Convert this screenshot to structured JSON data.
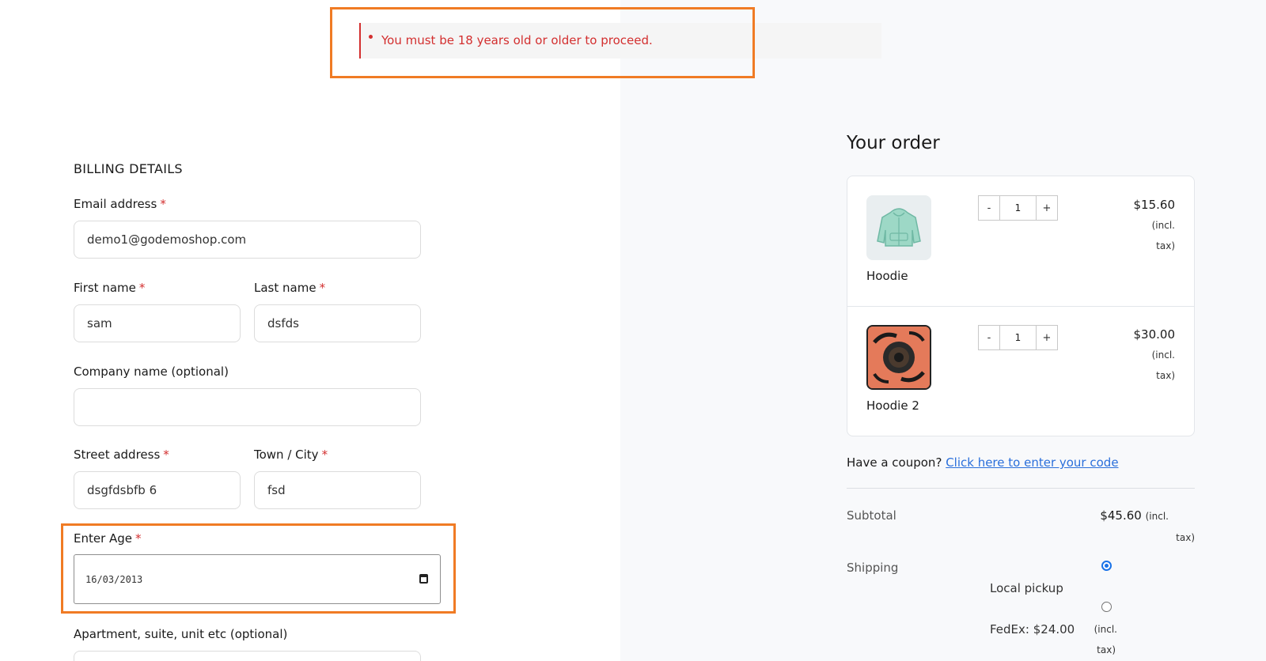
{
  "notice": {
    "message": "You must be 18 years old or older to proceed."
  },
  "billing": {
    "title": "BILLING DETAILS",
    "required_mark": "*",
    "email": {
      "label": "Email address",
      "value": "demo1@godemoshop.com"
    },
    "first_name": {
      "label": "First name",
      "value": "sam"
    },
    "last_name": {
      "label": "Last name",
      "value": "dsfds"
    },
    "company": {
      "label": "Company name (optional)",
      "value": ""
    },
    "street": {
      "label": "Street address",
      "value": "dsgfdsbfb 6"
    },
    "city": {
      "label": "Town / City",
      "value": "fsd"
    },
    "age": {
      "label": "Enter Age",
      "value": "16/03/2013"
    },
    "apartment": {
      "label": "Apartment, suite, unit etc (optional)",
      "value": ""
    }
  },
  "order": {
    "title": "Your order",
    "items": [
      {
        "name": "Hoodie",
        "qty": "1",
        "price": "$15.60",
        "tax_line1": "(incl.",
        "tax_line2": "tax)",
        "minus": "-",
        "plus": "+"
      },
      {
        "name": "Hoodie 2",
        "qty": "1",
        "price": "$30.00",
        "tax_line1": "(incl.",
        "tax_line2": "tax)",
        "minus": "-",
        "plus": "+"
      }
    ],
    "coupon_text": "Have a coupon?",
    "coupon_link": "Click here to enter your code",
    "subtotal_label": "Subtotal",
    "subtotal_value": "$45.60",
    "subtotal_tax1": "(incl.",
    "subtotal_tax2": "tax)",
    "shipping_label": "Shipping",
    "shipping_options": [
      {
        "label": "Local pickup",
        "selected": true
      },
      {
        "label": "FedEx: $24.00",
        "tax1": "(incl.",
        "tax2": "tax)",
        "selected": false
      }
    ]
  },
  "colors": {
    "error": "#d32f2f",
    "highlight": "#f07b24",
    "link": "#2a6fdb",
    "panel": "#f8f9fb"
  }
}
